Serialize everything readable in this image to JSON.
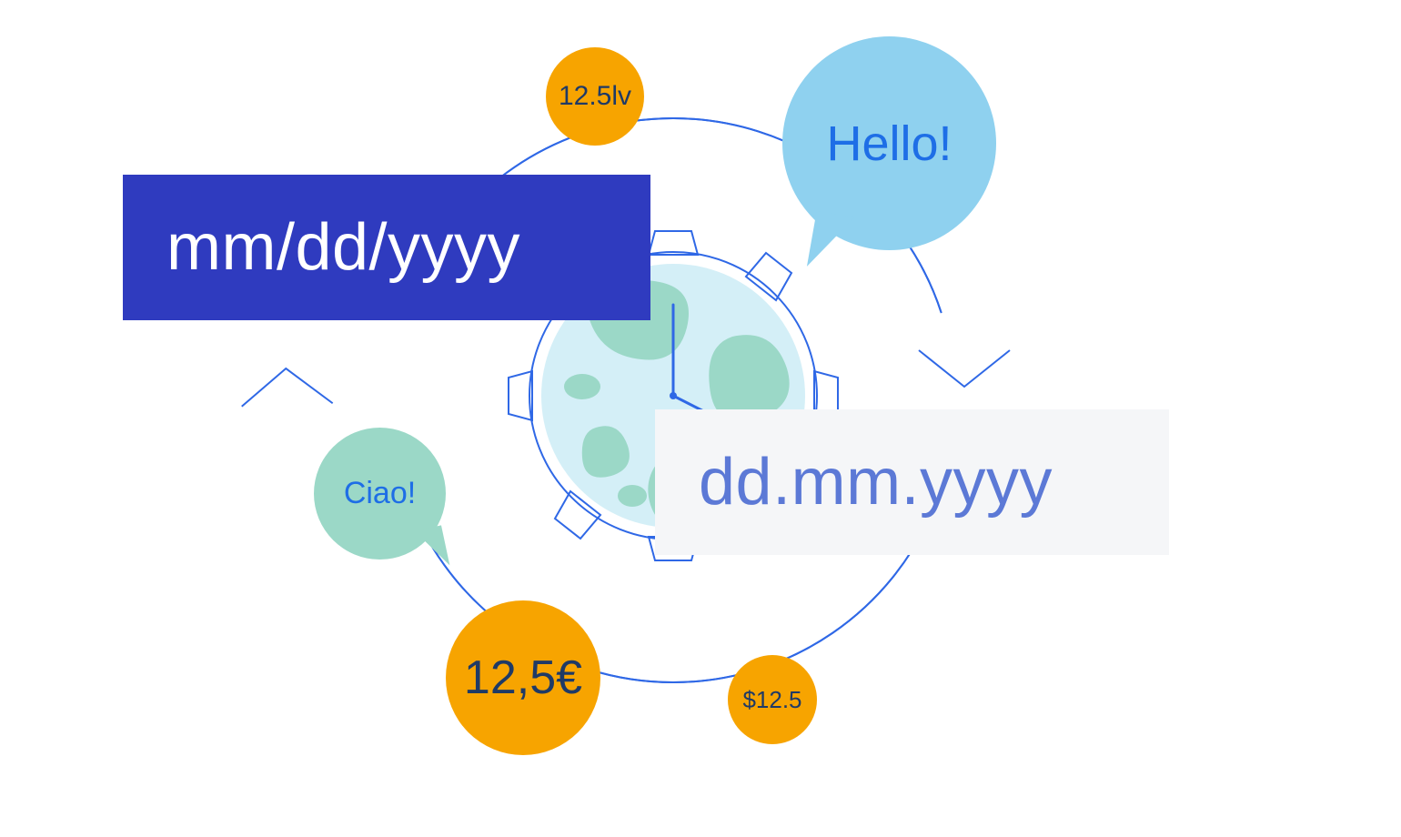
{
  "colors": {
    "indigo": "#2F3BBF",
    "lightgrey": "#F5F6F8",
    "periwinkle": "#5C79D6",
    "orange": "#F7A400",
    "navy_text": "#1F3A66",
    "sky": "#8FD1EF",
    "mint": "#9BD8C7",
    "link_blue": "#1E6EE6",
    "stroke_blue": "#2F68E6",
    "land": "#9BD8C7",
    "ocean": "#D4EFF7"
  },
  "date_formats": {
    "us": "mm/dd/yyyy",
    "eu": "dd.mm.yyyy"
  },
  "currency": {
    "lv": "12.5lv",
    "eur": "12,5€",
    "usd": "$12.5"
  },
  "greetings": {
    "en": "Hello!",
    "it": "Ciao!"
  }
}
